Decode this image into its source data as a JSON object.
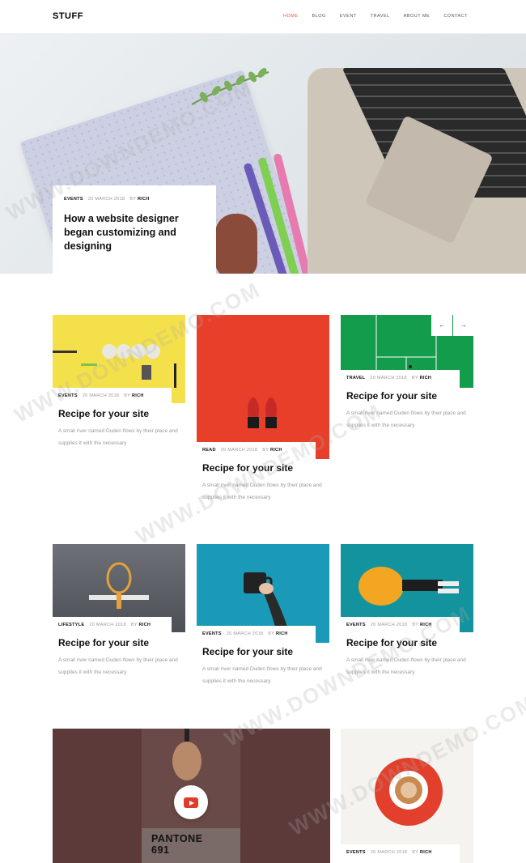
{
  "header": {
    "logo": "STUFF",
    "nav": [
      "HOME",
      "BLOG",
      "EVENT",
      "TRAVEL",
      "ABOUT ME",
      "CONTACT"
    ],
    "active_nav": "HOME"
  },
  "hero": {
    "category": "EVENTS",
    "date": "20 MARCH 2018",
    "by": "BY",
    "author": "RICH",
    "title": "How a website designer began customizing and designing"
  },
  "slider": {
    "prev": "←",
    "next": "→"
  },
  "posts": [
    {
      "category": "EVENTS",
      "date": "20 MARCH 2018",
      "by": "BY",
      "author": "RICH",
      "title": "Recipe for your site",
      "excerpt": "A small river named Duden flows by their place and supplies it with the necessary"
    },
    {
      "category": "READ",
      "date": "20 MARCH 2018",
      "by": "BY",
      "author": "RICH",
      "title": "Recipe for your site",
      "excerpt": "A small river named Duden flows by their place and supplies it with the necessary"
    },
    {
      "category": "TRAVEL",
      "date": "20 MARCH 2018",
      "by": "BY",
      "author": "RICH",
      "title": "Recipe for your site",
      "excerpt": "A small river named Duden flows by their place and supplies it with the necessary"
    },
    {
      "category": "LIFESTYLE",
      "date": "20 MARCH 2018",
      "by": "BY",
      "author": "RICH",
      "title": "Recipe for your site",
      "excerpt": "A small river named Duden flows by their place and supplies it with the necessary"
    },
    {
      "category": "EVENTS",
      "date": "20 MARCH 2018",
      "by": "BY",
      "author": "RICH",
      "title": "Recipe for your site",
      "excerpt": "A small river named Duden flows by their place and supplies it with the necessary"
    },
    {
      "category": "EVENTS",
      "date": "20 MARCH 2018",
      "by": "BY",
      "author": "RICH",
      "title": "Recipe for your site",
      "excerpt": "A small river named Duden flows by their place and supplies it with the necessary"
    }
  ],
  "video": {
    "label_line1": "PANTONE",
    "label_line2": "691",
    "icon": "youtube-play-icon"
  },
  "last_post": {
    "category": "EVENTS",
    "date": "20 MARCH 2018",
    "by": "BY",
    "author": "RICH"
  },
  "watermark": "WWW.DOWNDEMO.COM",
  "colors": {
    "accent": "#e8513f",
    "text": "#111111",
    "muted": "#999999"
  }
}
